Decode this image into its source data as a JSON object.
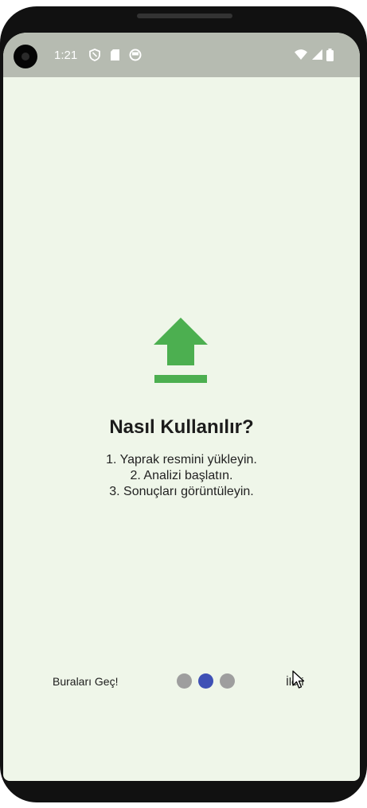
{
  "status_bar": {
    "time": "1:21",
    "icons": [
      "shield-icon",
      "sd-card-icon",
      "face-circle-icon",
      "wifi-icon",
      "signal-icon",
      "battery-icon"
    ]
  },
  "onboarding": {
    "icon": "upload-icon",
    "icon_color": "#4caf50",
    "title": "Nasıl Kullanılır?",
    "steps": [
      "1. Yaprak resmini yükleyin.",
      "2. Analizi başlatın.",
      "3. Sonuçları görüntüleyin."
    ]
  },
  "footer": {
    "skip_label": "Buraları Geç!",
    "next_label": "İleri",
    "page_indicator": {
      "total": 3,
      "current": 2,
      "active_color": "#3f51b5",
      "inactive_color": "#9e9e9e"
    }
  },
  "colors": {
    "background": "#eff6e9",
    "status_bar": "#b6bbb1"
  }
}
